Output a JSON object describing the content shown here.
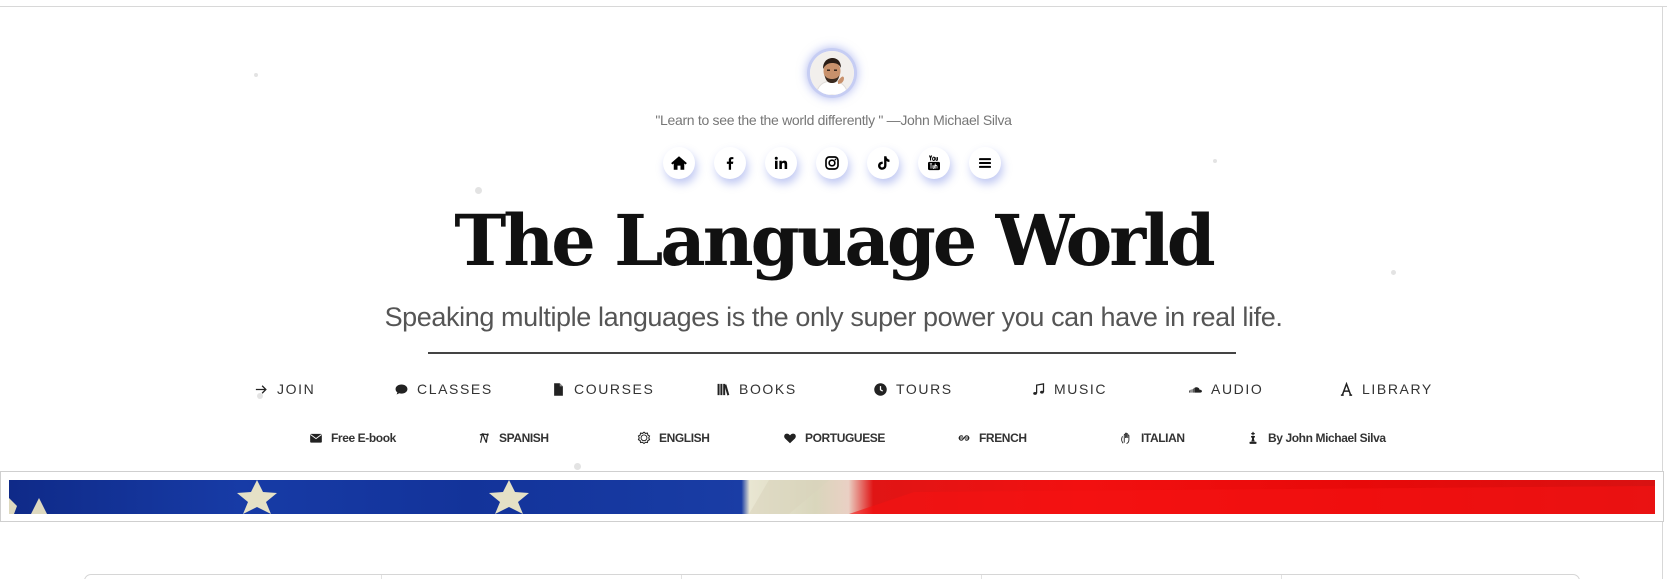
{
  "profile": {
    "quote": "\"Learn to see the the world differently \" —John Michael Silva"
  },
  "social": [
    {
      "id": "home",
      "icon": "home-icon"
    },
    {
      "id": "facebook",
      "icon": "facebook-icon"
    },
    {
      "id": "linkedin",
      "icon": "linkedin-icon"
    },
    {
      "id": "instagram",
      "icon": "instagram-icon"
    },
    {
      "id": "tiktok",
      "icon": "tiktok-icon"
    },
    {
      "id": "youtube",
      "icon": "youtube-icon"
    },
    {
      "id": "menu",
      "icon": "hamburger-menu-icon"
    }
  ],
  "hero": {
    "title": "The Language World",
    "tagline": "Speaking multiple languages is the only super power you can have in real life."
  },
  "nav_primary": [
    {
      "label": "JOIN",
      "icon": "arrow-right-icon"
    },
    {
      "label": "CLASSES",
      "icon": "chat-bubble-icon"
    },
    {
      "label": "COURSES",
      "icon": "file-icon"
    },
    {
      "label": "BOOKS",
      "icon": "books-icon"
    },
    {
      "label": "TOURS",
      "icon": "clock-icon"
    },
    {
      "label": "MUSIC",
      "icon": "music-note-icon"
    },
    {
      "label": "AUDIO",
      "icon": "soundcloud-icon"
    },
    {
      "label": "LIBRARY",
      "icon": "font-letter-icon"
    }
  ],
  "nav_secondary": [
    {
      "label": "Free E-book",
      "icon": "envelope-icon"
    },
    {
      "label": "SPANISH",
      "icon": "spanish-glyph-icon"
    },
    {
      "label": "ENGLISH",
      "icon": "badge-icon"
    },
    {
      "label": "PORTUGUESE",
      "icon": "heart-icon"
    },
    {
      "label": "FRENCH",
      "icon": "french-glyph-icon"
    },
    {
      "label": "ITALIAN",
      "icon": "hand-icon"
    },
    {
      "label": "By John Michael Silva",
      "icon": "chess-king-icon"
    }
  ],
  "colors": {
    "accent_glow": "#6e7de1",
    "title": "#111111",
    "flag_blue": "#173ba6",
    "flag_red": "#f21010"
  }
}
